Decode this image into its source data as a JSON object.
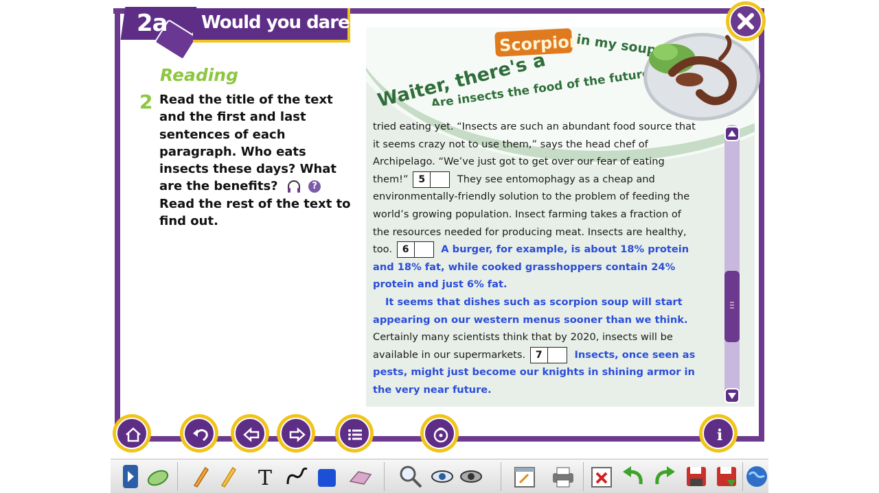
{
  "header": {
    "unit": "2a",
    "title": "Would you dare?"
  },
  "task": {
    "section": "Reading",
    "number": "2",
    "text_part1": "Read the title of the text and the first and last sentences of each paragraph. Who eats insects these days? What are the benefits?",
    "help_mark": "?",
    "text_part2": "Read the rest of the text to find out."
  },
  "article": {
    "headline_part1": "Waiter, there's a",
    "headline_highlight": "Scorpion",
    "headline_part2": "in my soup!",
    "subheadline": "Are insects the food of the future?",
    "lines_a": "tried eating yet. “Insects are such an abundant food source that it seems crazy not to use them,” says the head chef of Archipelago. “We’ve just got to get over our fear of eating them!”",
    "gap5": "5",
    "lines_b": "They see entomophagy as a cheap and environmentally-friendly solution to the problem of feeding the world’s growing population. Insect farming takes a fraction of the resources needed for producing meat. Insects are healthy, too.",
    "gap6": "6",
    "answer6": "A burger, for example, is about 18% protein and 18% fat, while cooked grasshoppers contain 24% protein and just 6% fat.",
    "answer_para": "It seems that dishes such as scorpion soup will start appearing on our western menus sooner than we think.",
    "lines_c": "Certainly many scientists think that by 2020, insects will be available in our supermarkets.",
    "gap7": "7",
    "answer7": "Insects, once seen as pests, might just become our knights in shining armor in the very near future."
  },
  "scroll": {
    "position_fraction": 0.75
  },
  "nav": {
    "buttons": [
      "home-icon",
      "undo-curve-icon",
      "arrow-left-icon",
      "arrow-right-icon",
      "list-icon",
      "audio-disc-icon",
      "info-icon"
    ],
    "info_mark": "i"
  },
  "toolbar": {
    "text_tool_label": "T",
    "tools": [
      "expand-icon",
      "mouse-icon",
      "pencil-icon",
      "marker-icon",
      "text-icon",
      "freehand-icon",
      "shape-icon",
      "eraser-icon",
      "zoom-icon",
      "reveal-icon",
      "hide-icon",
      "note-icon",
      "print-icon",
      "clear-icon",
      "undo-icon",
      "redo-icon",
      "save-icon",
      "save-as-icon",
      "web-icon"
    ]
  },
  "colors": {
    "brand_purple": "#5e2d86",
    "accent_yellow": "#f0c419",
    "section_green": "#8dc63f",
    "answer_blue": "#2a4dd8"
  }
}
